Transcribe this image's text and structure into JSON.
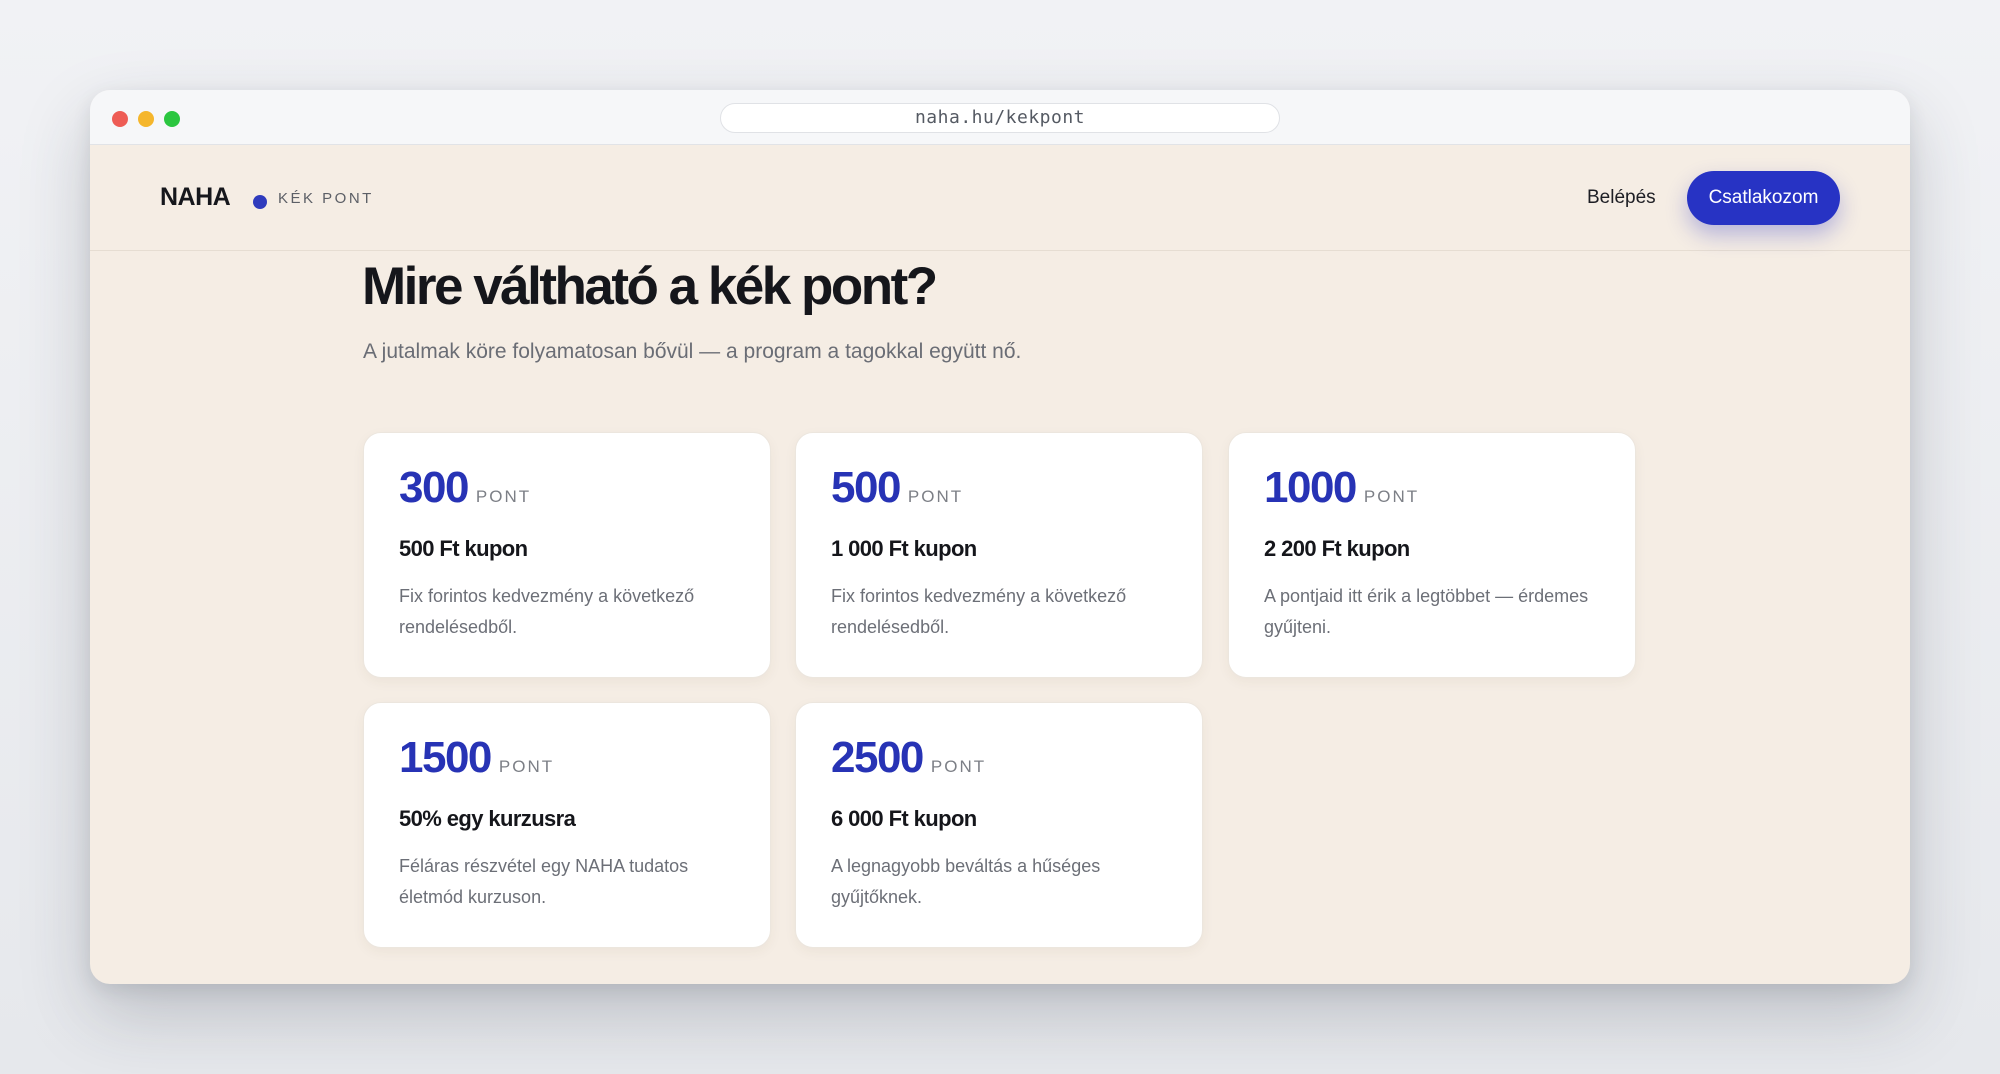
{
  "browser": {
    "url": "naha.hu/kekpont"
  },
  "header": {
    "brand": "NAHA",
    "brand_sub": "KÉK PONT",
    "login_label": "Belépés",
    "join_label": "Csatlakozom"
  },
  "main": {
    "title": "Mire váltható a kék pont?",
    "subtitle": "A jutalmak köre folyamatosan bővül — a program a tagokkal együtt nő.",
    "cards": [
      {
        "points": "300",
        "unit": "PONT",
        "reward": "500 Ft kupon",
        "description": "Fix forintos kedvezmény a következő rendelésedből."
      },
      {
        "points": "500",
        "unit": "PONT",
        "reward": "1 000 Ft kupon",
        "description": "Fix forintos kedvezmény a következő rendelésedből."
      },
      {
        "points": "1000",
        "unit": "PONT",
        "reward": "2 200 Ft kupon",
        "description": "A pontjaid itt érik a legtöbbet — érdemes gyűjteni."
      },
      {
        "points": "1500",
        "unit": "PONT",
        "reward": "50% egy kurzusra",
        "description": "Féláras részvétel egy NAHA tudatos életmód kurzuson."
      },
      {
        "points": "2500",
        "unit": "PONT",
        "reward": "6 000 Ft kupon",
        "description": "A legnagyobb beváltás a hűséges gyűjtőknek."
      }
    ]
  },
  "colors": {
    "accent": "#2733c4",
    "points": "#2733b5",
    "page_background": "#f5ede4",
    "card_background": "#ffffff"
  }
}
